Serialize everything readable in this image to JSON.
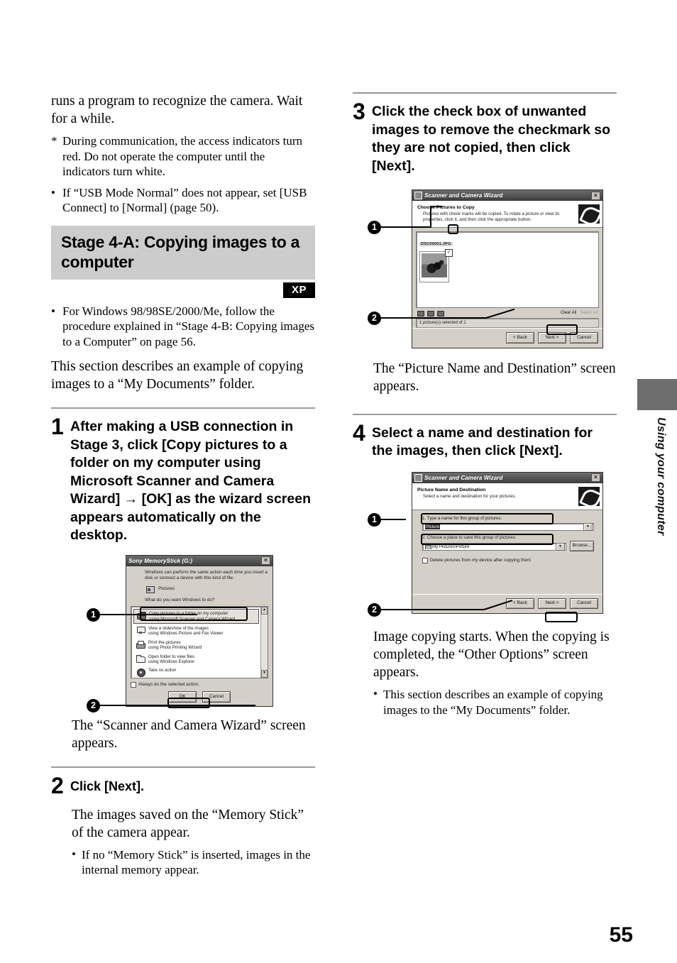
{
  "page": {
    "number": "55",
    "side_tab_label": "Using your computer"
  },
  "left_column": {
    "intro_paragraph": "runs a program to recognize the camera. Wait for a while.",
    "note_star_marker": "*",
    "note_star": "During communication, the access indicators turn red. Do not operate the computer until the indicators turn white.",
    "note_bullet_marker": "•",
    "note_bullet": "If “USB Mode Normal” does not appear, set [USB Connect] to [Normal] (page 50).",
    "banner_title": "Stage 4-A: Copying images to a computer",
    "xp_badge": "XP",
    "windows_note_marker": "•",
    "windows_note": "For Windows 98/98SE/2000/Me, follow the procedure explained in “Stage 4-B: Copying images to a Computer” on page 56.",
    "section_intro": "This section describes an example of copying images to a “My Documents” folder."
  },
  "steps": {
    "step1": {
      "number": "1",
      "title": "After making a USB connection in Stage 3, click [Copy pictures to a folder on my computer using Microsoft Scanner and Camera Wizard] → [OK] as the wizard screen appears automatically on the desktop.",
      "result": "The “Scanner and Camera Wizard” screen appears."
    },
    "step2": {
      "number": "2",
      "title": "Click [Next].",
      "result": "The images saved on the “Memory Stick” of the camera appear.",
      "note_marker": "•",
      "note": "If no “Memory Stick” is inserted, images in the internal memory appear."
    },
    "step3": {
      "number": "3",
      "title": "Click the check box of unwanted images to remove the checkmark so they are not copied, then click [Next].",
      "result": "The “Picture Name and Destination” screen appears."
    },
    "step4": {
      "number": "4",
      "title": "Select a name and destination for the images, then click [Next].",
      "result": "Image copying starts. When the copying is completed, the “Other Options” screen appears.",
      "note_marker": "•",
      "note": "This section describes an example of copying images to the “My Documents” folder."
    }
  },
  "callouts": {
    "one": "1",
    "two": "2"
  },
  "dialog_autoplay": {
    "title": "Sony MemoryStick (G:)",
    "close_label": "✕",
    "intro": "Windows can perform the same action each time you insert a disk or connect a device with this kind of file:",
    "file_type": "Pictures",
    "prompt": "What do you want Windows to do?",
    "options": [
      {
        "line1": "Copy pictures to a folder on my computer",
        "line2": "using Microsoft Scanner and Camera Wizard",
        "icon": "camera-icon",
        "selected": true
      },
      {
        "line1": "View a slideshow of the images",
        "line2": "using Windows Picture and Fax Viewer",
        "icon": "monitor-icon",
        "selected": false
      },
      {
        "line1": "Print the pictures",
        "line2": "using Photo Printing Wizard",
        "icon": "printer-icon",
        "selected": false
      },
      {
        "line1": "Open folder to view files",
        "line2": "using Windows Explorer",
        "icon": "folder-icon",
        "selected": false
      },
      {
        "line1": "Take no action",
        "line2": "",
        "icon": "disc-icon",
        "selected": false
      }
    ],
    "checkbox_label": "Always do the selected action.",
    "ok_label": "OK",
    "cancel_label": "Cancel",
    "scroll_up": "▲",
    "scroll_down": "▼"
  },
  "dialog_choose_pictures": {
    "title": "Scanner and Camera Wizard",
    "close_label": "✕",
    "heading": "Choose Pictures to Copy",
    "description": "Pictures with check marks will be copied. To rotate a picture or view its properties, click it, and then click the appropriate button.",
    "group_label": "DSC00001.JPG",
    "thumb_check": "✓",
    "clear_all": "Clear All",
    "select_all": "Select All",
    "status": "1 picture(s) selected of 1",
    "back_label": "< Back",
    "next_label": "Next >",
    "cancel_label": "Cancel"
  },
  "dialog_name_destination": {
    "title": "Scanner and Camera Wizard",
    "close_label": "✕",
    "heading": "Picture Name and Destination",
    "description": "Select a name and destination for your pictures.",
    "field1_label": "1. Type a name for this group of pictures:",
    "field1_value": "Picture",
    "field2_label": "2. Choose a place to save this group of pictures:",
    "field2_value": "My Pictures\\Picture",
    "browse_label": "Browse...",
    "delete_checkbox_label": "Delete pictures from my device after copying them",
    "combo_arrow": "▼",
    "back_label": "< Back",
    "next_label": "Next >",
    "cancel_label": "Cancel"
  }
}
